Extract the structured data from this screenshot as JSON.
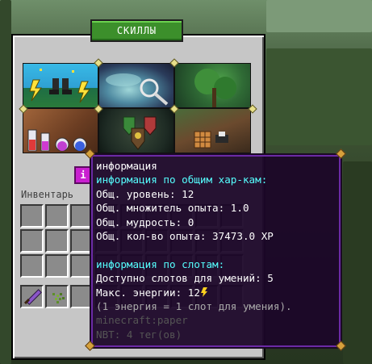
{
  "window": {
    "tab_label": "СКИЛЛЫ",
    "info_badge": "i",
    "inventory_label": "Инвентарь"
  },
  "skill_tiles": [
    {
      "name": "tile-agility"
    },
    {
      "name": "tile-foraging"
    },
    {
      "name": "tile-farming"
    },
    {
      "name": "tile-alchemy"
    },
    {
      "name": "tile-defense"
    },
    {
      "name": "tile-crafting"
    }
  ],
  "inventory": {
    "rows": 3,
    "cols": 9,
    "hotbar": [
      "sword",
      "seeds",
      "",
      "",
      "",
      "",
      "",
      "",
      ""
    ]
  },
  "tooltip": {
    "title": "информация",
    "section1_heading": "информация по общим хар-кам:",
    "level": "Общ. уровень: 12",
    "xp_multiplier": "Общ. множитель опыта: 1.0",
    "wisdom": "Общ. мудрость: 0",
    "total_xp": "Общ. кол-во опыта: 37473.0 XP",
    "section2_heading": "информация по слотам:",
    "skill_slots": "Доступно слотов для умений: 5",
    "max_energy": "Макс. энергии: 12",
    "energy_note": "(1 энергия = 1 слот для умения).",
    "item_id": "minecraft:paper",
    "nbt": "NBT: 4 тег(ов)"
  },
  "colors": {
    "tooltip_heading": "#55ffff",
    "tooltip_text": "#ffffff",
    "tooltip_note": "#aaaaaa",
    "tooltip_id": "#555555",
    "tooltip_border": "#6b2aa5",
    "tab_green": "#3c8f2b"
  }
}
